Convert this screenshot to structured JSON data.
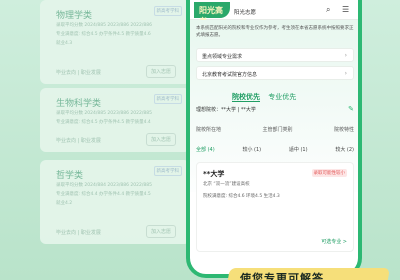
{
  "bg_cards": [
    {
      "title": "物理学类",
      "badge": "新高考学科",
      "lines": [
        "录取平均分数 2024/885 2023/886 2022/886",
        "专业满意度: 综合4.5 办学条件4.5 教学质量4.6",
        "就业4.3"
      ],
      "footer": "毕业去向 | 职业发展",
      "button": "加入志愿"
    },
    {
      "title": "生物科学类",
      "badge": "新高考学科",
      "lines": [
        "录取平均分数 2024/885 2023/886 2022/885",
        "专业满意度: 综合4.5 办学条件4.5 教学质量4.4"
      ],
      "footer": "毕业去向 | 职业发展",
      "button": "加入志愿"
    },
    {
      "title": "哲学类",
      "badge": "新高考学科",
      "lines": [
        "录取平均分数 2024/884 2023/886 2022/885",
        "专业满意度: 综合4.4 办学条件4.4 教学质量4.5",
        "就业4.2"
      ],
      "footer": "毕业去向 | 职业发展",
      "button": "加入志愿"
    }
  ],
  "phone": {
    "logo_text": "阳光高考",
    "title": "阳光志愿",
    "search_icon": "search-icon",
    "menu_icon": "menu-icon",
    "intro": "本系统匹配阳光的院校和专业仅作为参考，考生须在本省志愿系统中按照要求正式填报志愿。",
    "links": [
      "重点领域专业需求",
      "北京教育考试院官方信息"
    ],
    "tabs": [
      "院校优先",
      "专业优先"
    ],
    "ideal_label": "理想院校：**大学 | **大学",
    "filters": [
      "院校所在地",
      "主管部门类别",
      "院校特性"
    ],
    "subtabs": [
      "全部 (4)",
      "较小 (1)",
      "适中 (1)",
      "较大 (2)"
    ],
    "card": {
      "name": "**大学",
      "tag": "录取可能性较小",
      "location": "北京 “双一流”建设高校",
      "meta": "院校满意度: 综合4.6 环境4.5 生活4.3",
      "button": "可选专业 >"
    }
  },
  "banner": "使您专更可解答",
  "colors": {
    "accent": "#2db873",
    "bg": "#bfe6d1"
  }
}
